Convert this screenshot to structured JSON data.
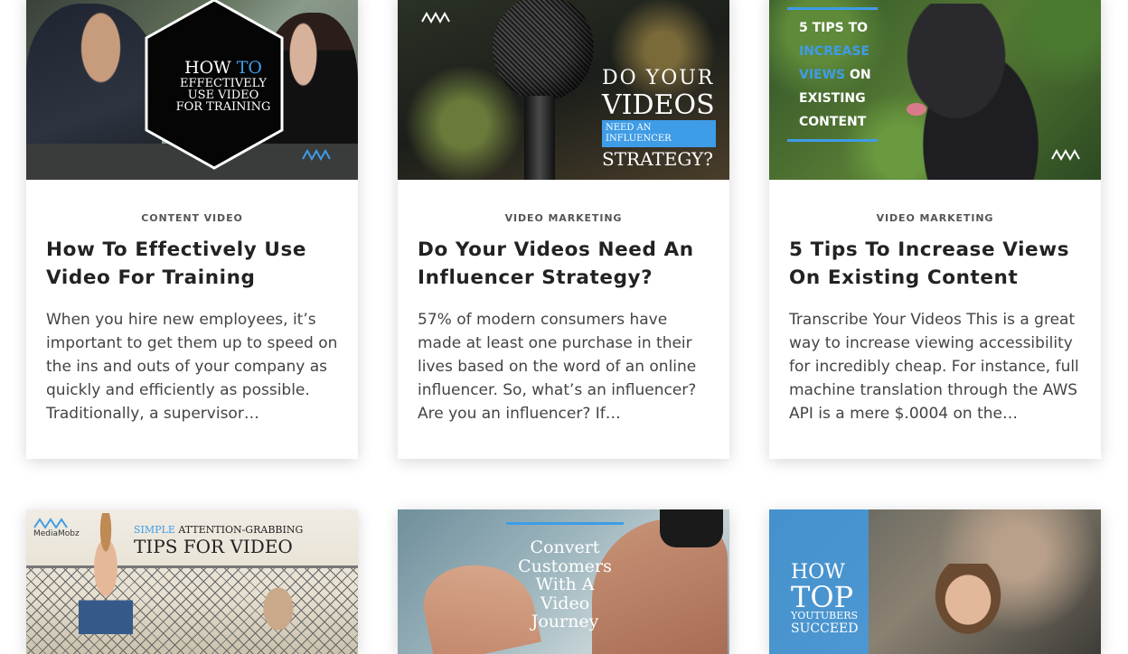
{
  "posts": [
    {
      "category": "CONTENT VIDEO",
      "title": "How To Effectively Use Video For Training",
      "excerpt": "When you hire new employees, it’s important to get them up to speed on the ins and outs of your company as quickly and efficiently as possible. Traditionally, a supervisor…",
      "thumb": {
        "line1a": "HOW",
        "line1b": "TO",
        "line2": "EFFECTIVELY",
        "line3": "USE VIDEO",
        "line4": "FOR TRAINING"
      }
    },
    {
      "category": "VIDEO MARKETING",
      "title": "Do Your Videos Need An Influencer Strategy?",
      "excerpt": "57% of modern consumers have made at least one purchase in their lives based on the word of an online influencer. So, what’s an influencer? Are you an influencer? If…",
      "thumb": {
        "line1": "DO YOUR",
        "line2": "VIDEOS",
        "line3": "NEED AN INFLUENCER",
        "line4": "STRATEGY?"
      }
    },
    {
      "category": "VIDEO MARKETING",
      "title": "5 Tips To Increase Views On Existing Content",
      "excerpt": "Transcribe Your Videos This is a great way to increase viewing accessibility for incredibly cheap. For instance, full machine translation through the AWS API is a mere $.0004 on the…",
      "thumb": {
        "line1": "5 TIPS TO",
        "line2": "INCREASE",
        "line3a": "VIEWS",
        "line3b": "ON",
        "line4": "EXISTING",
        "line5": "CONTENT"
      }
    },
    {
      "thumb": {
        "brand": "MediaMobz",
        "line1a": "SIMPLE",
        "line1b": "ATTENTION-GRABBING",
        "line2": "TIPS FOR VIDEO"
      }
    },
    {
      "thumb": {
        "line1": "Convert",
        "line2": "Customers",
        "line3": "With A",
        "line4": "Video",
        "line5": "Journey"
      }
    },
    {
      "thumb": {
        "line1": "HOW",
        "line2": "TOP",
        "line3": "YOUTUBERS",
        "line4": "SUCCEED"
      }
    }
  ],
  "colors": {
    "accent_blue": "#3f9ce6",
    "title": "#222222",
    "category": "#555555",
    "excerpt": "#444444"
  }
}
